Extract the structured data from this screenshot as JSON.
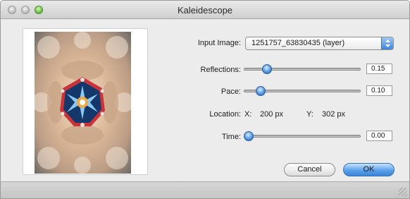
{
  "window": {
    "title": "Kaleidescope"
  },
  "form": {
    "input_image": {
      "label": "Input Image:",
      "value": "1251757_63830435 (layer)"
    },
    "reflections": {
      "label": "Reflections:",
      "value": "0.15",
      "level": 0.15
    },
    "pace": {
      "label": "Pace:",
      "value": "0.10",
      "level": 0.1
    },
    "location": {
      "label": "Location:",
      "x_label": "X:",
      "x_value": "200 px",
      "y_label": "Y:",
      "y_value": "302 px"
    },
    "time": {
      "label": "Time:",
      "value": "0.00",
      "level": 0.0
    }
  },
  "buttons": {
    "cancel": "Cancel",
    "ok": "OK"
  }
}
